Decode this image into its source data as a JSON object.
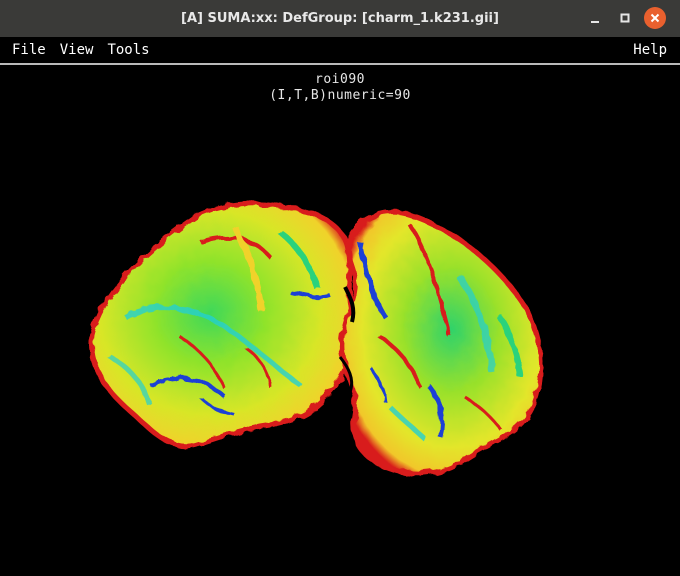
{
  "window": {
    "title": "[A] SUMA:xx: DefGroup: [charm_1.k231.gii]",
    "controls": [
      "minimize-icon",
      "maximize-icon",
      "close-icon"
    ],
    "close_color": "#e9602e"
  },
  "menu": {
    "file": "File",
    "view": "View",
    "tools": "Tools",
    "help": "Help"
  },
  "viewer": {
    "roi_label": "roi090",
    "value_label": "(I,T,B)numeric=90",
    "background": "#000000",
    "colormap": [
      "#d81b1b",
      "#f4e321",
      "#7ee02a",
      "#27d35a",
      "#1ec9c4",
      "#1a3fd6"
    ]
  }
}
